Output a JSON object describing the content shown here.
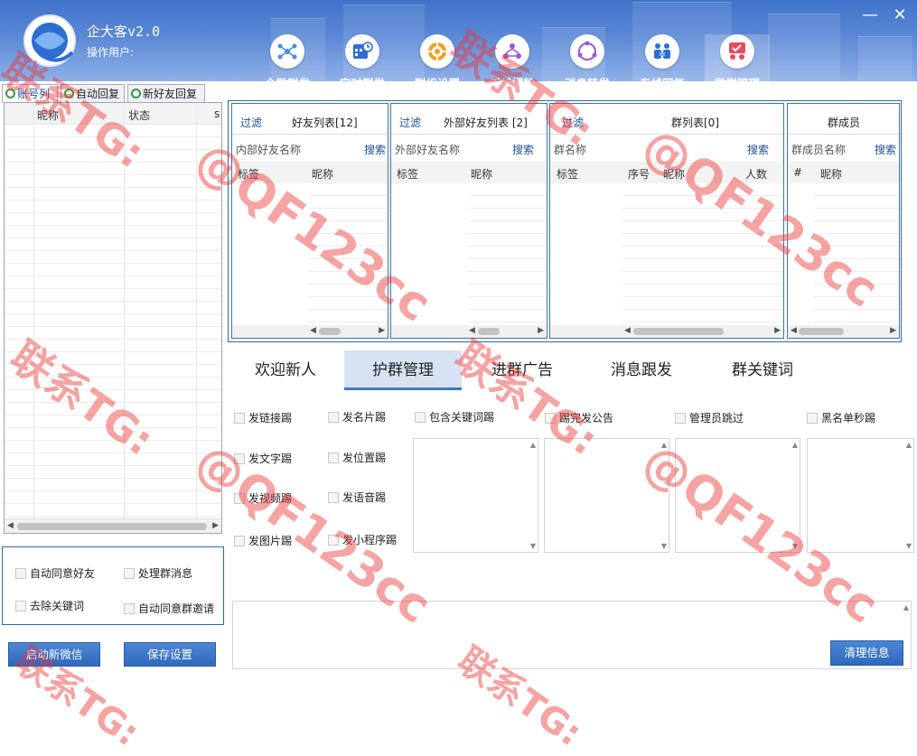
{
  "app": {
    "title": "企大客v2.0",
    "operator_label": "操作用户:"
  },
  "window": {
    "minimize": "—",
    "close": "✕"
  },
  "toolbar": [
    {
      "label": "企微群发",
      "icon": "share-network-icon",
      "color": "#4a8fe0"
    },
    {
      "label": "定时群发",
      "icon": "schedule-calendar-icon",
      "color": "#2f6ed0"
    },
    {
      "label": "群组设置",
      "icon": "gear-group-icon",
      "color": "#f0a020"
    },
    {
      "label": "手机爆粉",
      "icon": "phone-fans-icon",
      "color": "#9b59d0"
    },
    {
      "label": "消息转发",
      "icon": "forward-circle-icon",
      "color": "#9b59d0"
    },
    {
      "label": "专线回复",
      "icon": "team-reply-icon",
      "color": "#2f6ed0"
    },
    {
      "label": "微群管理",
      "icon": "group-manage-icon",
      "color": "#e84a5f"
    }
  ],
  "left_tabs": [
    "账号列",
    "自动回复",
    "新好友回复"
  ],
  "account_grid": {
    "col1": "昵称",
    "col2": "状态",
    "col3": "s"
  },
  "options": {
    "auto_accept_friend": "自动同意好友",
    "handle_group_msg": "处理群消息",
    "remove_keywords": "去除关键词",
    "auto_accept_invite": "自动同意群邀请"
  },
  "buttons": {
    "start_wechat": "启动新微信",
    "save_settings": "保存设置",
    "clear_info": "清理信息"
  },
  "lists": {
    "friends": {
      "filter": "过滤",
      "title": "好友列表[12]",
      "field": "内部好友名称",
      "search": "搜索",
      "col1": "标签",
      "col2": "昵称"
    },
    "external": {
      "filter": "过滤",
      "title": "外部好友列表 [2]",
      "field": "外部好友名称",
      "search": "搜索",
      "col1": "标签",
      "col2": "昵称"
    },
    "groups": {
      "filter": "过滤",
      "title": "群列表[0]",
      "field": "群名称",
      "search": "搜索",
      "col1": "标签",
      "col2": "序号",
      "col3": "昵称",
      "col4": "人数"
    },
    "members": {
      "title": "群成员",
      "field": "群成员名称",
      "search": "搜索",
      "col1": "#",
      "col2": "昵称"
    }
  },
  "content_tabs": [
    "欢迎新人",
    "护群管理",
    "进群广告",
    "消息跟发",
    "群关键词"
  ],
  "active_tab": "护群管理",
  "kick": {
    "link": "发链接踢",
    "card": "发名片踢",
    "text": "发文字踢",
    "location": "发位置踢",
    "video": "发视频踢",
    "voice": "发语音踢",
    "image": "发图片踢",
    "miniprogram": "发小程序踢",
    "keyword": "包含关键词踢",
    "announce": "踢完发公告",
    "admin_skip": "管理员跳过",
    "blacklist": "黑名单秒踢"
  },
  "watermark": {
    "line1": "联系TG:",
    "line2": "@QF123cc",
    "color": "#ec3232"
  }
}
